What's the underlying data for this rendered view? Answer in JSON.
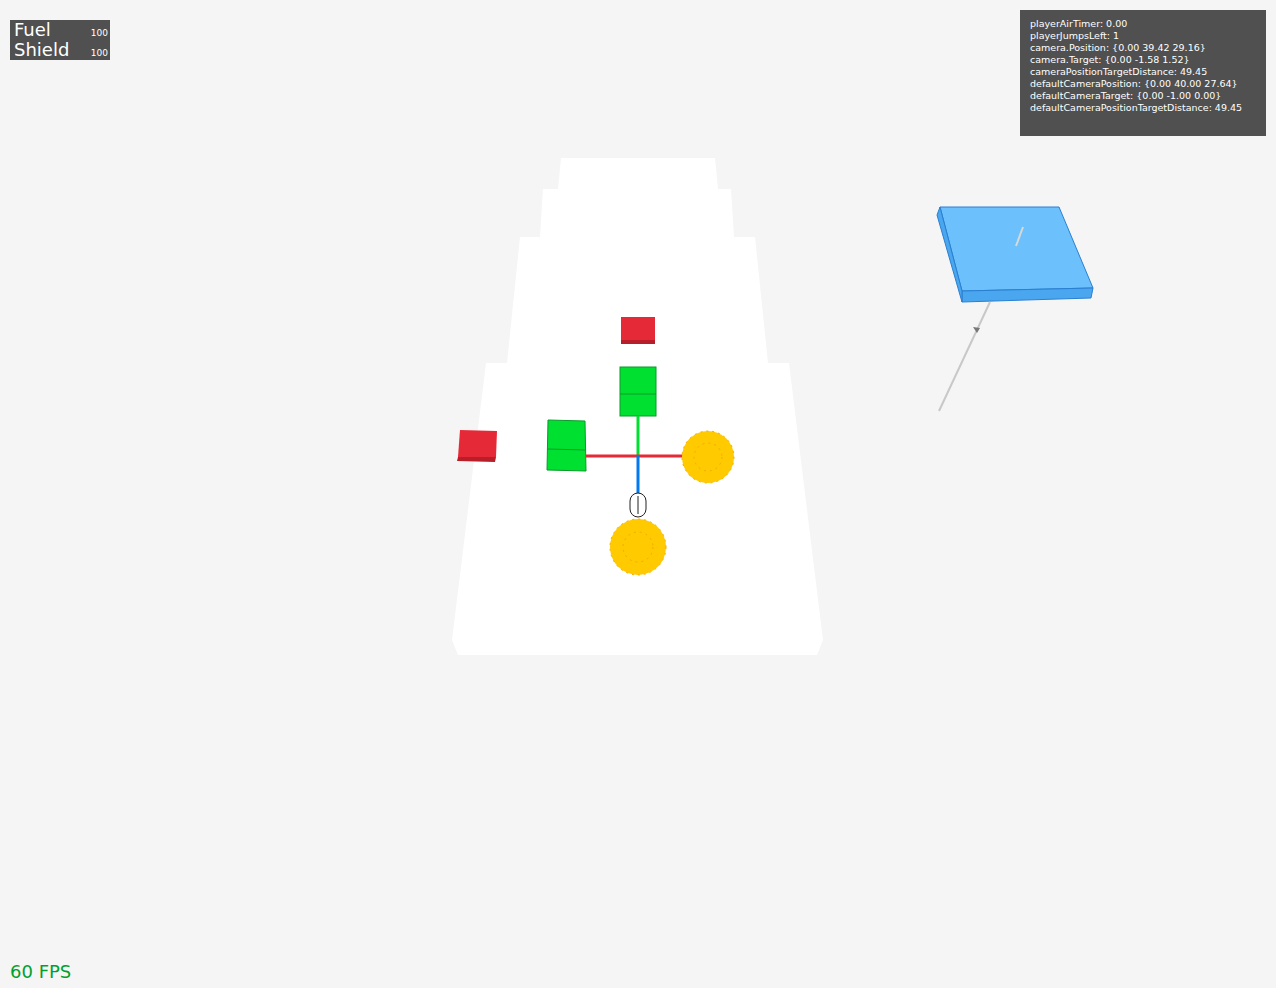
{
  "hud": {
    "stats": [
      {
        "label": "Fuel",
        "value": "100"
      },
      {
        "label": "Shield",
        "value": "100"
      }
    ]
  },
  "debug": {
    "lines": [
      "playerAirTimer: 0.00",
      "playerJumpsLeft: 1",
      "camera.Position: {0.00 39.42 29.16}",
      "camera.Target: {0.00 -1.58 1.52}",
      "cameraPositionTargetDistance: 49.45",
      "defaultCameraPosition: {0.00 40.00 27.64}",
      "defaultCameraTarget: {0.00 -1.00 0.00}",
      "defaultCameraPositionTargetDistance: 49.45"
    ]
  },
  "fps": "60 FPS"
}
